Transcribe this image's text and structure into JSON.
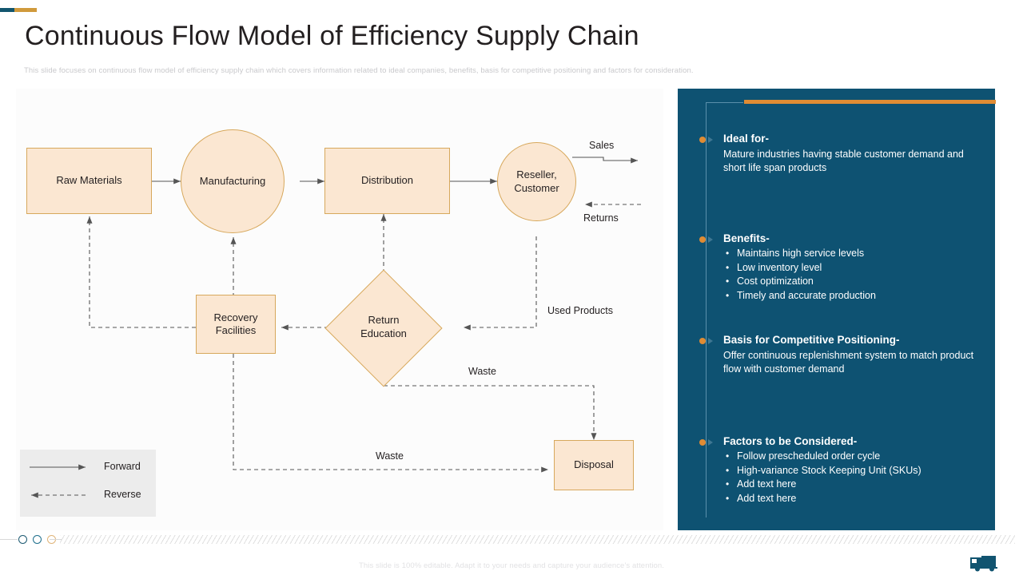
{
  "header": {
    "title": "Continuous Flow Model of Efficiency Supply Chain",
    "subtitle": "This slide focuses on continuous flow model of efficiency supply chain which covers information related to ideal companies, benefits, basis for competitive positioning and factors for consideration."
  },
  "colors": {
    "panel_bg": "#0e5272",
    "accent_orange": "#e08c34",
    "accent_teal": "#12556e",
    "node_fill": "#fbe7d2",
    "node_border": "#d7a85c",
    "title_text": "#231f20"
  },
  "diagram": {
    "nodes": {
      "raw_materials": "Raw Materials",
      "manufacturing": "Manufacturing",
      "distribution": "Distribution",
      "reseller_customer": "Reseller,\nCustomer",
      "reseller_line1": "Reseller,",
      "reseller_line2": "Customer",
      "recovery_line1": "Recovery",
      "recovery_line2": "Facilities",
      "return_line1": "Return",
      "return_line2": "Education",
      "disposal": "Disposal"
    },
    "edge_labels": {
      "sales": "Sales",
      "returns": "Returns",
      "used_products": "Used Products",
      "waste_top": "Waste",
      "waste_bottom": "Waste"
    },
    "legend": {
      "forward": "Forward",
      "reverse": "Reverse"
    }
  },
  "panel": {
    "blocks": [
      {
        "heading": "Ideal for-",
        "body": "Mature industries having stable customer demand and short life span products",
        "items": []
      },
      {
        "heading": "Benefits-",
        "body": "",
        "items": [
          "Maintains high service levels",
          "Low inventory level",
          "Cost optimization",
          "Timely and accurate production"
        ]
      },
      {
        "heading": "Basis for Competitive Positioning-",
        "body": "Offer continuous replenishment system to match product flow with customer demand",
        "items": []
      },
      {
        "heading": "Factors to be Considered-",
        "body": "",
        "items": [
          "Follow prescheduled order cycle",
          "High-variance Stock Keeping Unit (SKUs)",
          "Add text here",
          "Add text here"
        ]
      }
    ]
  },
  "footer": {
    "note": "This slide is 100% editable. Adapt it to your needs and capture your audience's attention.",
    "dots": [
      "#1d5a72",
      "#1d6e8c",
      "#e0b57a"
    ],
    "logo": "truck-icon"
  }
}
